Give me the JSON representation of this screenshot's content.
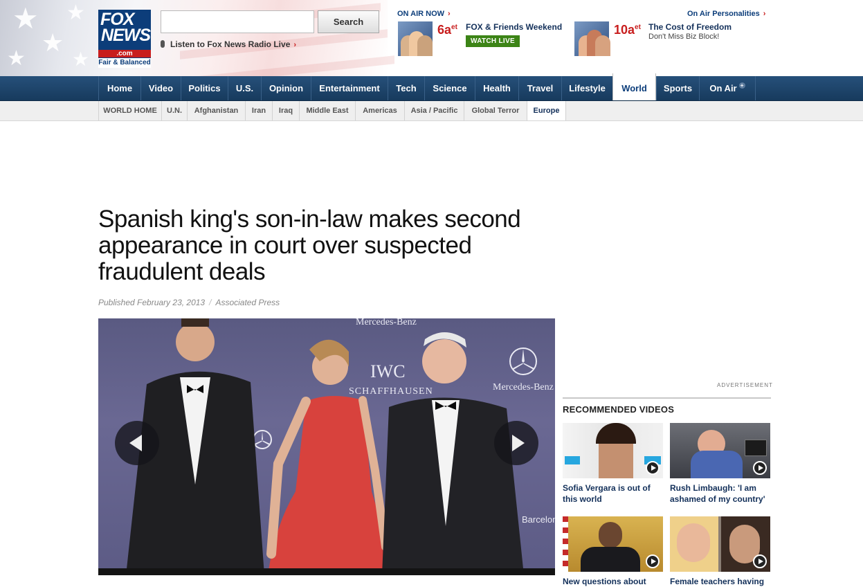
{
  "header": {
    "logo": {
      "line1": "FOX",
      "line2": "NEWS",
      "com": ".com",
      "tagline": "Fair & Balanced"
    },
    "search": {
      "placeholder": "",
      "button_label": "Search"
    },
    "radio_link": "Listen to Fox News Radio Live",
    "on_air_now": {
      "label": "ON AIR NOW",
      "time": "6a",
      "time_suffix": "et",
      "show": "FOX & Friends Weekend",
      "watch_label": "WATCH LIVE"
    },
    "personalities": {
      "label": "On Air Personalities",
      "time": "10a",
      "time_suffix": "et",
      "show": "The Cost of Freedom",
      "subtitle": "Don't Miss Biz Block!"
    }
  },
  "nav": {
    "items": [
      "Home",
      "Video",
      "Politics",
      "U.S.",
      "Opinion",
      "Entertainment",
      "Tech",
      "Science",
      "Health",
      "Travel",
      "Lifestyle",
      "World",
      "Sports",
      "On Air"
    ],
    "active": "World"
  },
  "subnav": {
    "items": [
      "WORLD HOME",
      "U.N.",
      "Afghanistan",
      "Iran",
      "Iraq",
      "Middle East",
      "Americas",
      "Asia / Pacific",
      "Global Terror",
      "Europe"
    ],
    "active": "Europe"
  },
  "article": {
    "headline": "Spanish king's son-in-law makes second appearance in court over suspected fraudulent deals",
    "published": "Published February 23, 2013",
    "source": "Associated Press",
    "photo_text": {
      "mercedes_top": "Mercedes-Benz",
      "iwc": "IWC",
      "schaffhausen": "SCHAFFHAUSEN",
      "mercedes_right": "Mercedes-Benz",
      "barcelona": "Barcelona"
    }
  },
  "sidebar": {
    "ad_label": "ADVERTISEMENT",
    "recommended_title": "RECOMMENDED VIDEOS",
    "videos": [
      {
        "caption": "Sofia Vergara is out of this world"
      },
      {
        "caption": "Rush Limbaugh: 'I am ashamed of my country'"
      },
      {
        "caption": "New questions about"
      },
      {
        "caption": "Female teachers having"
      }
    ]
  },
  "colors": {
    "nav_blue": "#1f4a72",
    "brand_red": "#c81d1d",
    "link_navy": "#13305a",
    "watch_green": "#3c8416"
  }
}
